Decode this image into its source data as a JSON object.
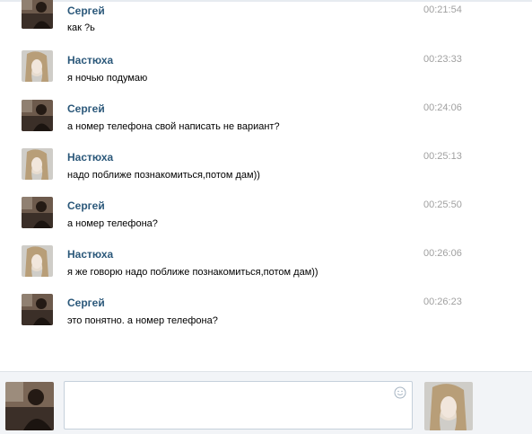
{
  "messages": [
    {
      "author": "Сергей",
      "time": "00:21:54",
      "text": "как ?ь",
      "avatar_icon": "male-avatar-icon"
    },
    {
      "author": "Настюха",
      "time": "00:23:33",
      "text": "я ночью подумаю",
      "avatar_icon": "female-avatar-icon"
    },
    {
      "author": "Сергей",
      "time": "00:24:06",
      "text": "а номер телефона свой написать не вариант?",
      "avatar_icon": "male-avatar-icon"
    },
    {
      "author": "Настюха",
      "time": "00:25:13",
      "text": "надо поближе познакомиться,потом дам))",
      "avatar_icon": "female-avatar-icon"
    },
    {
      "author": "Сергей",
      "time": "00:25:50",
      "text": "а номер телефона?",
      "avatar_icon": "male-avatar-icon"
    },
    {
      "author": "Настюха",
      "time": "00:26:06",
      "text": "я же говорю надо поближе познакомиться,потом дам))",
      "avatar_icon": "female-avatar-icon"
    },
    {
      "author": "Сергей",
      "time": "00:26:23",
      "text": "это понятно. а номер телефона?",
      "avatar_icon": "male-avatar-icon"
    }
  ],
  "compose": {
    "input_value": "",
    "input_placeholder": "",
    "emoji_icon": "smiley-icon",
    "self_avatar_icon": "male-avatar-icon",
    "peer_avatar_icon": "female-avatar-icon"
  },
  "colors": {
    "author_link": "#2b587a",
    "timestamp": "#a0a0a0",
    "compose_background": "#f2f4f7",
    "input_border": "#c5d0db"
  }
}
